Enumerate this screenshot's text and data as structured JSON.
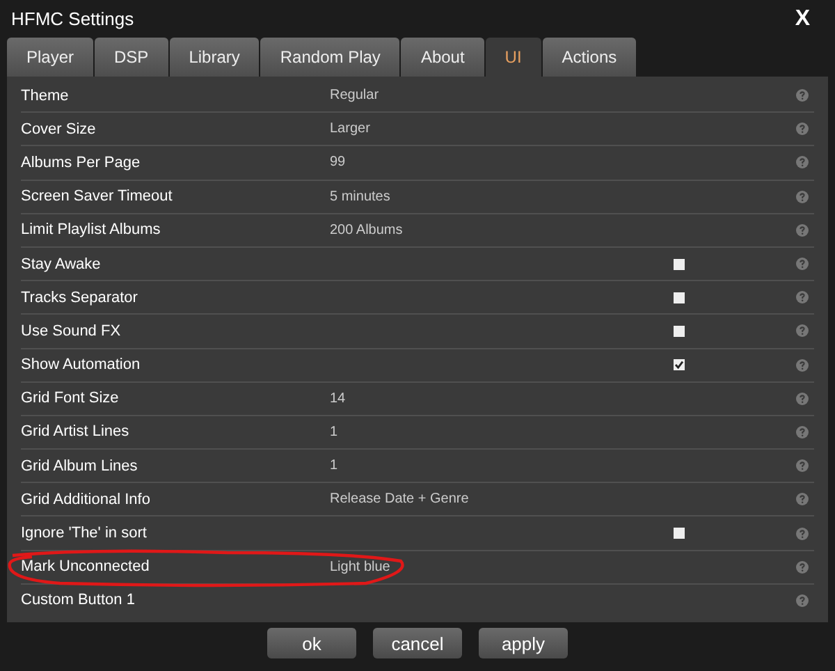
{
  "window": {
    "title": "HFMC Settings",
    "close": "X"
  },
  "tabs": [
    {
      "label": "Player",
      "selected": false
    },
    {
      "label": "DSP",
      "selected": false
    },
    {
      "label": "Library",
      "selected": false
    },
    {
      "label": "Random Play",
      "selected": false
    },
    {
      "label": "About",
      "selected": false
    },
    {
      "label": "UI",
      "selected": true
    },
    {
      "label": "Actions",
      "selected": false
    }
  ],
  "settings": [
    {
      "label": "Theme",
      "kind": "text",
      "value": "Regular"
    },
    {
      "label": "Cover Size",
      "kind": "text",
      "value": "Larger"
    },
    {
      "label": "Albums Per Page",
      "kind": "text",
      "value": "99"
    },
    {
      "label": "Screen Saver Timeout",
      "kind": "text",
      "value": "5 minutes"
    },
    {
      "label": "Limit Playlist Albums",
      "kind": "text",
      "value": "200 Albums"
    },
    {
      "label": "Stay Awake",
      "kind": "checkbox",
      "checked": false
    },
    {
      "label": "Tracks Separator",
      "kind": "checkbox",
      "checked": false
    },
    {
      "label": "Use Sound FX",
      "kind": "checkbox",
      "checked": false
    },
    {
      "label": "Show Automation",
      "kind": "checkbox",
      "checked": true
    },
    {
      "label": "Grid Font Size",
      "kind": "text",
      "value": "14"
    },
    {
      "label": "Grid Artist Lines",
      "kind": "text",
      "value": "1"
    },
    {
      "label": "Grid Album Lines",
      "kind": "text",
      "value": "1"
    },
    {
      "label": "Grid Additional Info",
      "kind": "text",
      "value": "Release Date + Genre"
    },
    {
      "label": "Ignore 'The' in sort",
      "kind": "checkbox",
      "checked": false
    },
    {
      "label": "Mark Unconnected",
      "kind": "text",
      "value": "Light blue",
      "circled": true
    },
    {
      "label": "Custom Button 1",
      "kind": "text"
    }
  ],
  "buttons": [
    "ok",
    "cancel",
    "apply"
  ]
}
